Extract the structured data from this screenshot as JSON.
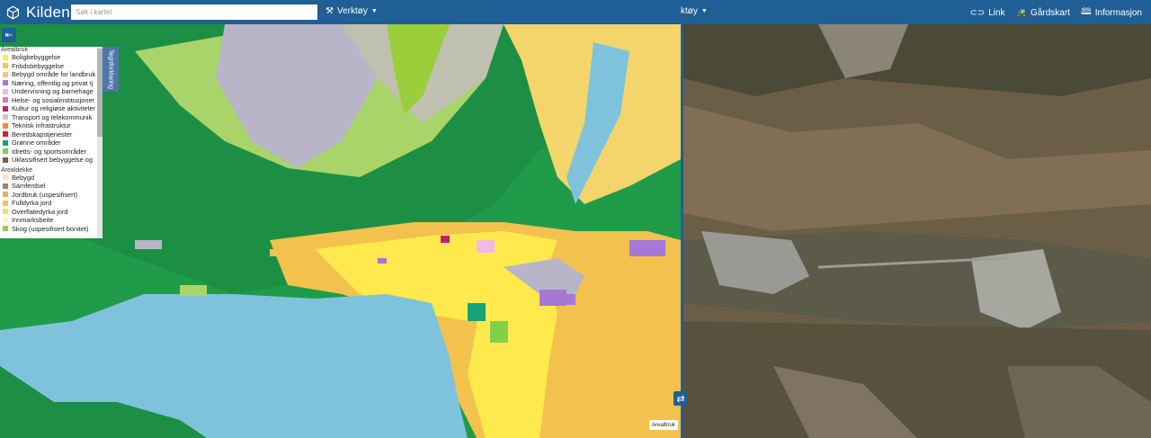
{
  "header": {
    "app_name": "Kilden",
    "search_placeholder": "Søk i kartet",
    "tools_label": "Verktøy",
    "center_label": "ktøy",
    "links": [
      {
        "label": "Link",
        "icon": "link-icon"
      },
      {
        "label": "Gårdskart",
        "icon": "tractor-icon"
      },
      {
        "label": "Informasjon",
        "icon": "book-icon"
      }
    ]
  },
  "legend": {
    "tab_label": "Tegnforklaring",
    "arealbruk": {
      "heading": "Arealbruk",
      "items": [
        {
          "label": "Boligbebyggelse",
          "color": "#ffe94d"
        },
        {
          "label": "Fritidsbebyggelse",
          "color": "#ffc04d"
        },
        {
          "label": "Bebygd område for landbruk",
          "color": "#f3c87a"
        },
        {
          "label": "Næring, offentlig og privat tj",
          "color": "#a678d6"
        },
        {
          "label": "Undervisning og barnehage",
          "color": "#f2b9e5"
        },
        {
          "label": "Helse- og sosialinstitusjoner",
          "color": "#ef6fae"
        },
        {
          "label": "Kultur og religiøse aktiviteter",
          "color": "#c21f70"
        },
        {
          "label": "Transport og telekommunik",
          "color": "#c8c8c8"
        },
        {
          "label": "Teknisk infrastruktur",
          "color": "#ff8c1a"
        },
        {
          "label": "Beredskapstjenester",
          "color": "#e01f1f"
        },
        {
          "label": "Grønne områder",
          "color": "#15a37a"
        },
        {
          "label": "Idretts- og sportsområder",
          "color": "#7fd14a"
        },
        {
          "label": "Uklassifisert bebyggelse og",
          "color": "#8c5a3c"
        }
      ]
    },
    "arealdekke": {
      "heading": "Arealdekke",
      "items": [
        {
          "label": "Bebygd",
          "color": "#f5e2d0"
        },
        {
          "label": "Samferdsel",
          "color": "#b07a6a"
        },
        {
          "label": "Jordbruk (uspesifisert)",
          "color": "#e8b06a"
        },
        {
          "label": "Fulldyrka jord",
          "color": "#f2c14e"
        },
        {
          "label": "Overflatedyrka jord",
          "color": "#ffd966"
        },
        {
          "label": "Innmarksbeite",
          "color": "#fff7c2"
        },
        {
          "label": "Skog (uspesifisert bonitet)",
          "color": "#8fd14f"
        }
      ]
    }
  },
  "map": {
    "layer_tag": "Arealbruk"
  },
  "colors": {
    "header_bg": "#1f5f96",
    "forest": "#1f9b4a",
    "water": "#7ec3db",
    "residential": "#ffe94d"
  }
}
